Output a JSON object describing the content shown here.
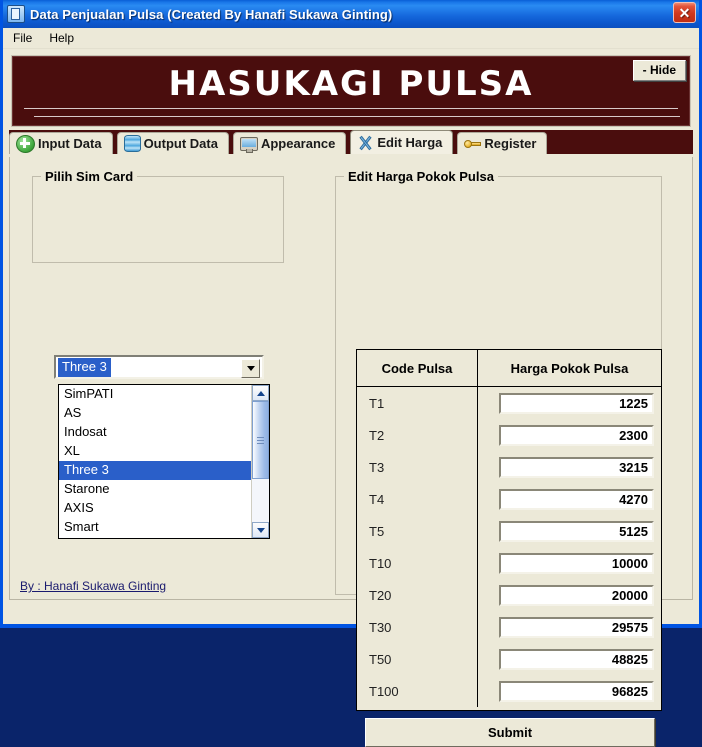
{
  "window": {
    "title": "Data Penjualan Pulsa (Created By Hanafi Sukawa Ginting)",
    "icon": "phone-icon",
    "close_label": "✕"
  },
  "menubar": {
    "items": [
      {
        "label": "File"
      },
      {
        "label": "Help"
      }
    ]
  },
  "banner": {
    "title": "HASUKAGI PULSA",
    "hide_label": "- Hide",
    "bg_color": "#4a0d0d",
    "text_color": "#ffffff"
  },
  "tabs": [
    {
      "label": "Input Data",
      "icon": "green-plus-icon",
      "active": false
    },
    {
      "label": "Output Data",
      "icon": "database-icon",
      "active": false
    },
    {
      "label": "Appearance",
      "icon": "monitor-icon",
      "active": false
    },
    {
      "label": "Edit Harga",
      "icon": "crossed-tools-icon",
      "active": true
    },
    {
      "label": "Register",
      "icon": "key-icon",
      "active": false
    }
  ],
  "sim_group": {
    "legend": "Pilih Sim Card",
    "combo": {
      "value": "Three 3",
      "arrow_icon": "chevron-down-icon"
    },
    "options": [
      {
        "label": "SimPATI",
        "selected": false
      },
      {
        "label": "AS",
        "selected": false
      },
      {
        "label": "Indosat",
        "selected": false
      },
      {
        "label": "XL",
        "selected": false
      },
      {
        "label": "Three 3",
        "selected": true
      },
      {
        "label": "Starone",
        "selected": false
      },
      {
        "label": "AXIS",
        "selected": false
      },
      {
        "label": "Smart",
        "selected": false
      }
    ],
    "selection_color": "#2a5fc9"
  },
  "harga_group": {
    "legend": "Edit Harga Pokok Pulsa",
    "columns": [
      "Code Pulsa",
      "Harga Pokok Pulsa"
    ],
    "rows": [
      {
        "code": "T1",
        "price": "1225"
      },
      {
        "code": "T2",
        "price": "2300"
      },
      {
        "code": "T3",
        "price": "3215"
      },
      {
        "code": "T4",
        "price": "4270"
      },
      {
        "code": "T5",
        "price": "5125"
      },
      {
        "code": "T10",
        "price": "10000"
      },
      {
        "code": "T20",
        "price": "20000"
      },
      {
        "code": "T30",
        "price": "29575"
      },
      {
        "code": "T50",
        "price": "48825"
      },
      {
        "code": "T100",
        "price": "96825"
      }
    ],
    "submit_label": "Submit"
  },
  "footer": {
    "credit": "By : Hanafi Sukawa Ginting"
  }
}
